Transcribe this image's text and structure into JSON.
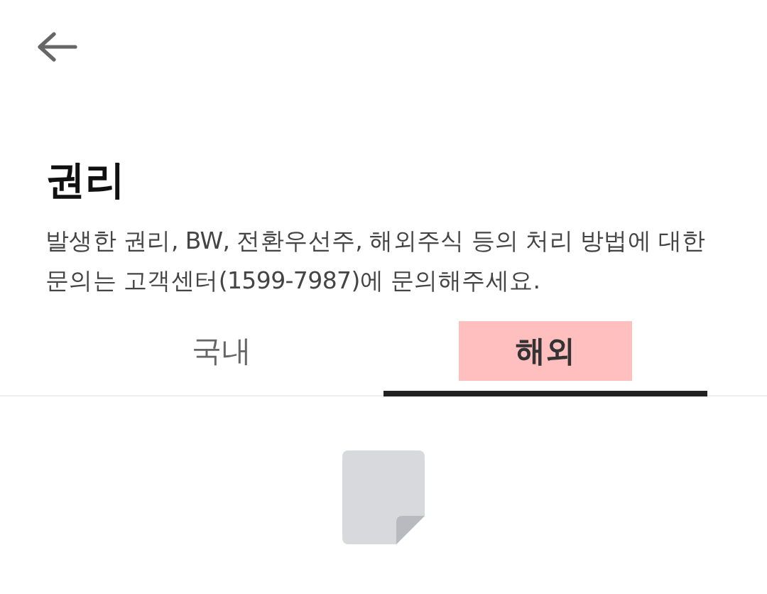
{
  "header": {
    "title": "권리",
    "description": "발생한 권리, BW, 전환우선주, 해외주식 등의 처리 방법에 대한 문의는 고객센터(1599-7987)에 문의해주세요."
  },
  "tabs": [
    {
      "label": "국내",
      "selected": false,
      "highlighted": false
    },
    {
      "label": "해외",
      "selected": true,
      "highlighted": true
    }
  ]
}
